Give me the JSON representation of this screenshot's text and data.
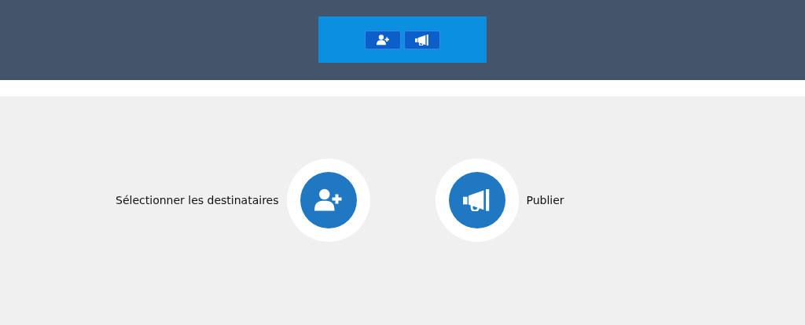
{
  "toolbar": {
    "buttons": [
      {
        "kind": "add-user"
      },
      {
        "kind": "megaphone"
      }
    ]
  },
  "steps": [
    {
      "kind": "add-user",
      "label": "Sélectionner les destinataires"
    },
    {
      "kind": "megaphone",
      "label": "Publier"
    }
  ]
}
